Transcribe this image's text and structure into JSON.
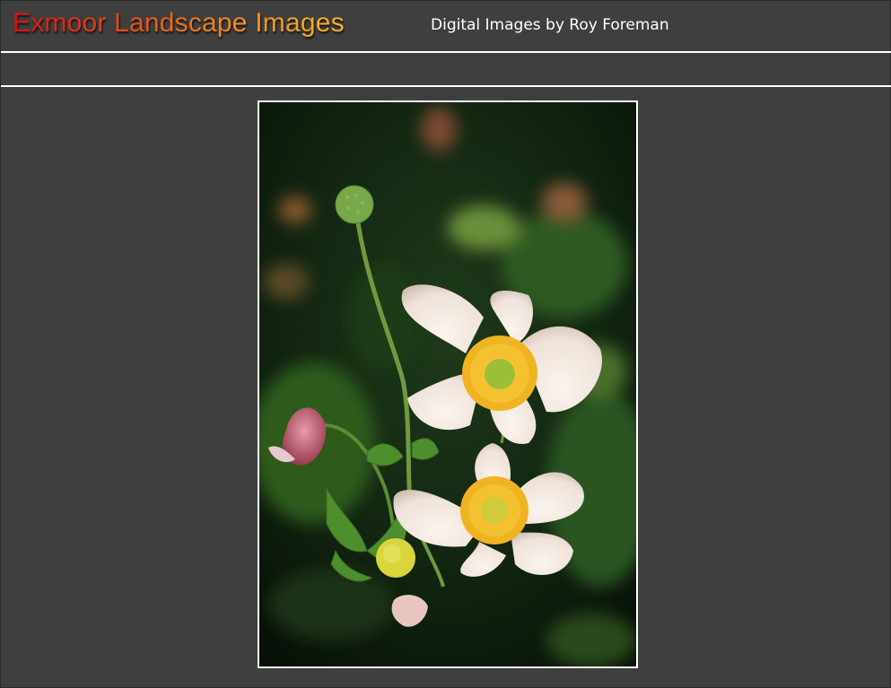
{
  "header": {
    "title": "Exmoor Landscape Images",
    "subtitle": "Digital Images by Roy Foreman"
  },
  "photo": {
    "alt": "White Japanese anemone flowers with yellow centres against a dark green background"
  }
}
